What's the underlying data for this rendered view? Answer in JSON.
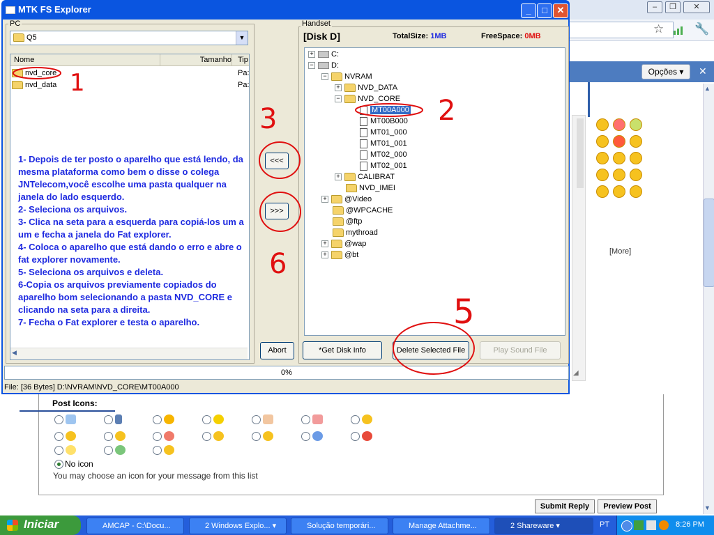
{
  "window": {
    "title": "MTK FS Explorer"
  },
  "pc": {
    "group_label": "PC",
    "combo_value": "Q5",
    "columns": [
      "Nome",
      "Tamanho",
      "Tip"
    ],
    "rows": [
      {
        "name": "nvd_core",
        "type": "Pa:"
      },
      {
        "name": "nvd_data",
        "type": "Pa:"
      }
    ]
  },
  "instructions": [
    "1- Depois de ter posto o aparelho que está lendo, da mesma plataforma como bem o disse o colega JNTelecom,você escolhe uma pasta qualquer na janela do lado esquerdo.",
    "2- Seleciona os arquivos.",
    "3- Clica na seta para a esquerda para copiá-los um a um e fecha a janela do Fat explorer.",
    "4- Coloca o aparelho que está dando o erro e abre o fat explorer novamente.",
    "5- Seleciona os arquivos e deleta.",
    "6-Copia os arquivos previamente copiados do aparelho bom selecionando a pasta NVD_CORE e clicando na seta para a direita.",
    "7- Fecha o Fat explorer e testa o aparelho."
  ],
  "transfer": {
    "left_label": "<<<",
    "right_label": ">>>",
    "abort_label": "Abort"
  },
  "handset": {
    "group_label": "Handset",
    "disk_label": "[Disk D]",
    "total_label": "TotalSize:",
    "total_value": "1MB",
    "free_label": "FreeSpace:",
    "free_value": "0MB",
    "tree": {
      "c": "C:",
      "d": "D:",
      "nvram": "NVRAM",
      "nvd_data": "NVD_DATA",
      "nvd_core": "NVD_CORE",
      "files": [
        "MT00A000",
        "MT00B000",
        "MT01_000",
        "MT01_001",
        "MT02_000",
        "MT02_001"
      ],
      "calibrat": "CALIBRAT",
      "nvd_imei": "NVD_IMEI",
      "others": [
        "@Video",
        "@WPCACHE",
        "@ftp",
        "mythroad",
        "@wap",
        "@bt"
      ]
    },
    "buttons": {
      "get_disk_info": "*Get Disk Info",
      "delete_file": "Delete Selected File",
      "play_sound": "Play Sound File"
    }
  },
  "progress_text": "0%",
  "status_text": "File: [36 Bytes] D:\\NVRAM\\NVD_CORE\\MT00A000",
  "annotations": {
    "n1": "1",
    "n2": "2",
    "n3": "3",
    "n5": "5",
    "n6": "6"
  },
  "browser": {
    "opcoes_label": "Opções",
    "more_label": "[More]",
    "post_icons_label": "Post Icons:",
    "no_icon_label": "No icon",
    "no_icon_help": "You may choose an icon for your message from this list",
    "submit_label": "Submit Reply",
    "preview_label": "Preview Post"
  },
  "taskbar": {
    "start_label": "Iniciar",
    "tasks": [
      "AMCAP - C:\\Docu...",
      "2 Windows Explo...",
      "Solução temporári...",
      "Manage Attachme...",
      "2 Shareware"
    ],
    "lang": "PT",
    "clock": "8:26 PM"
  },
  "colors": {
    "annotation_red": "#e01010",
    "instruction_blue": "#1f2be0",
    "xp_blue": "#0a55e0"
  }
}
